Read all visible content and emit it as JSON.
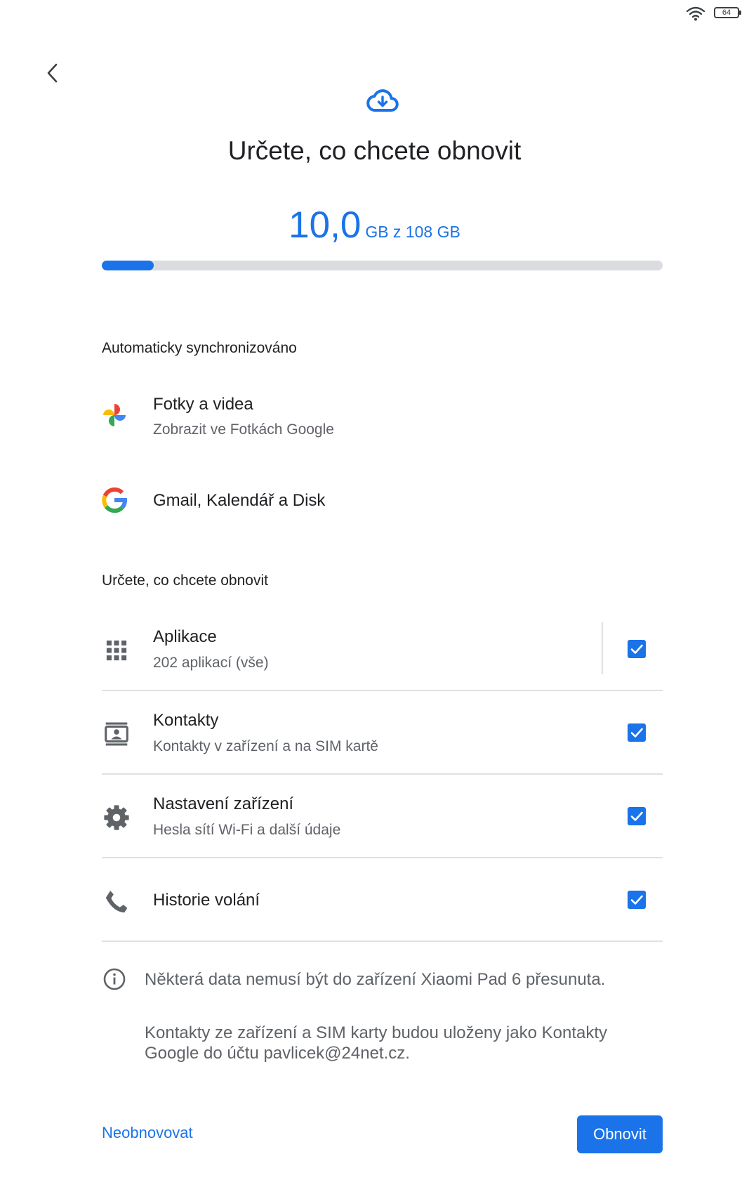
{
  "status_bar": {
    "battery_level": "64"
  },
  "header": {
    "title": "Určete, co chcete obnovit"
  },
  "storage": {
    "used": "10,0",
    "rest": "GB z 108 GB",
    "fraction": 0.093
  },
  "auto_sync": {
    "header": "Automaticky synchronizováno",
    "items": [
      {
        "title": "Fotky a videa",
        "subtitle": "Zobrazit ve Fotkách Google",
        "icon": "google-photos-icon"
      },
      {
        "title": "Gmail, Kalendář a Disk",
        "icon": "google-g-icon"
      }
    ]
  },
  "restore": {
    "header": "Určete, co chcete obnovit",
    "items": [
      {
        "title": "Aplikace",
        "subtitle": "202 aplikací (vše)",
        "icon": "apps-grid-icon",
        "checked": true
      },
      {
        "title": "Kontakty",
        "subtitle": "Kontakty v zařízení a na SIM kartě",
        "icon": "contacts-icon",
        "checked": true
      },
      {
        "title": "Nastavení zařízení",
        "subtitle": "Hesla sítí Wi-Fi a další údaje",
        "icon": "gear-icon",
        "checked": true
      },
      {
        "title": "Historie volání",
        "icon": "phone-icon",
        "checked": true
      }
    ]
  },
  "info": {
    "line1": "Některá data nemusí být do zařízení Xiaomi Pad 6 přesunuta.",
    "line2a": "Kontakty ze zařízení a SIM karty budou uloženy jako Kontakty",
    "line2b": "Google do účtu pavlicek@24net.cz."
  },
  "actions": {
    "skip_label": "Neobnovovat",
    "restore_label": "Obnovit"
  },
  "colors": {
    "accent": "#1a73e8",
    "track": "#dadce0",
    "divider": "#e0e0e0"
  }
}
